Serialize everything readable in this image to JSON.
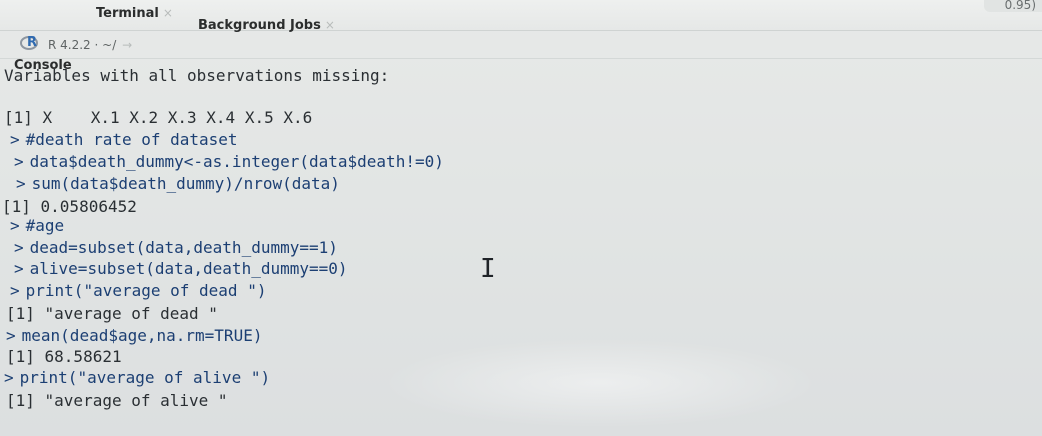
{
  "tabs": {
    "console": "Console",
    "terminal": "Terminal",
    "background_jobs": "Background Jobs",
    "close_glyph": "×"
  },
  "corner_badge": "0.95)",
  "path": {
    "version": "R 4.2.2",
    "separator": "·",
    "dir": "~/",
    "arrow": "→"
  },
  "console": {
    "lines": [
      {
        "prompt": "",
        "text": "Variables with all observations missing:"
      },
      {
        "prompt": "",
        "text": "[1] X    X.1 X.2 X.3 X.4 X.5 X.6"
      },
      {
        "prompt": ">",
        "text": "#death rate of dataset"
      },
      {
        "prompt": ">",
        "text": "data$death_dummy<-as.integer(data$death!=0)"
      },
      {
        "prompt": ">",
        "text": "sum(data$death_dummy)/nrow(data)"
      },
      {
        "prompt": "",
        "text": "[1] 0.05806452"
      },
      {
        "prompt": ">",
        "text": "#age"
      },
      {
        "prompt": ">",
        "text": "dead=subset(data,death_dummy==1)"
      },
      {
        "prompt": ">",
        "text": "alive=subset(data,death_dummy==0)"
      },
      {
        "prompt": ">",
        "text": "print(\"average of dead \")"
      },
      {
        "prompt": "",
        "text": "[1] \"average of dead \""
      },
      {
        "prompt": ">",
        "text": "mean(dead$age,na.rm=TRUE)"
      },
      {
        "prompt": "",
        "text": "[1] 68.58621"
      },
      {
        "prompt": ">",
        "text": "print(\"average of alive \")"
      },
      {
        "prompt": "",
        "text": "[1] \"average of alive \""
      }
    ]
  },
  "cursor_glyph": "I"
}
